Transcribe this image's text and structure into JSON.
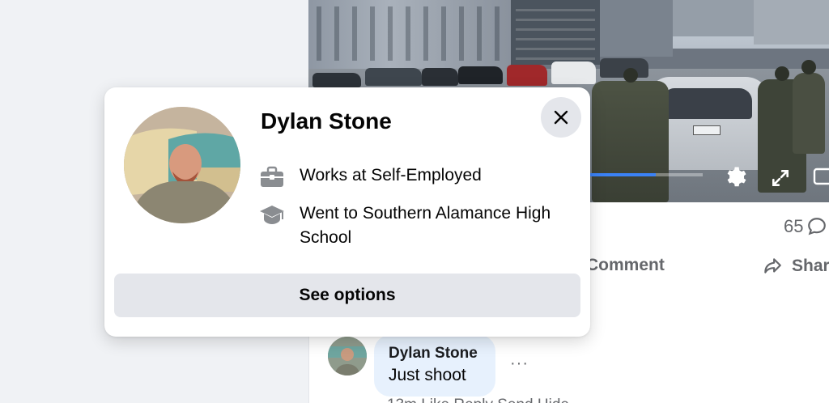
{
  "hovercard": {
    "name": "Dylan Stone",
    "close_icon": "close-icon",
    "work": {
      "icon": "briefcase-icon",
      "text": "Works at Self-Employed"
    },
    "education": {
      "icon": "graduation-cap-icon",
      "text": "Went to Southern Alamance High School"
    },
    "button_label": "See options"
  },
  "post": {
    "video": {
      "progress": 0.88,
      "settings_icon": "gear-icon",
      "fullscreen_icon": "fullscreen-icon",
      "pip_icon": "picture-in-picture-icon"
    },
    "comment_count": "65",
    "comment_count_icon": "comment-bubble-icon",
    "actions": [
      {
        "label": "Comment",
        "icon": "comment-icon"
      },
      {
        "label": "Share",
        "icon": "share-icon"
      }
    ]
  },
  "comment": {
    "author": "Dylan Stone",
    "text": "Just shoot",
    "more_label": "···",
    "meta": "13m   Like   Reply   Send   Hide"
  },
  "colors": {
    "page_bg": "#f0f2f5",
    "card_bg": "#ffffff",
    "button_bg": "#e4e6eb",
    "comment_bubble": "#e7f1fd",
    "progress": "#3b82f6",
    "secondary_text": "#65676b"
  }
}
